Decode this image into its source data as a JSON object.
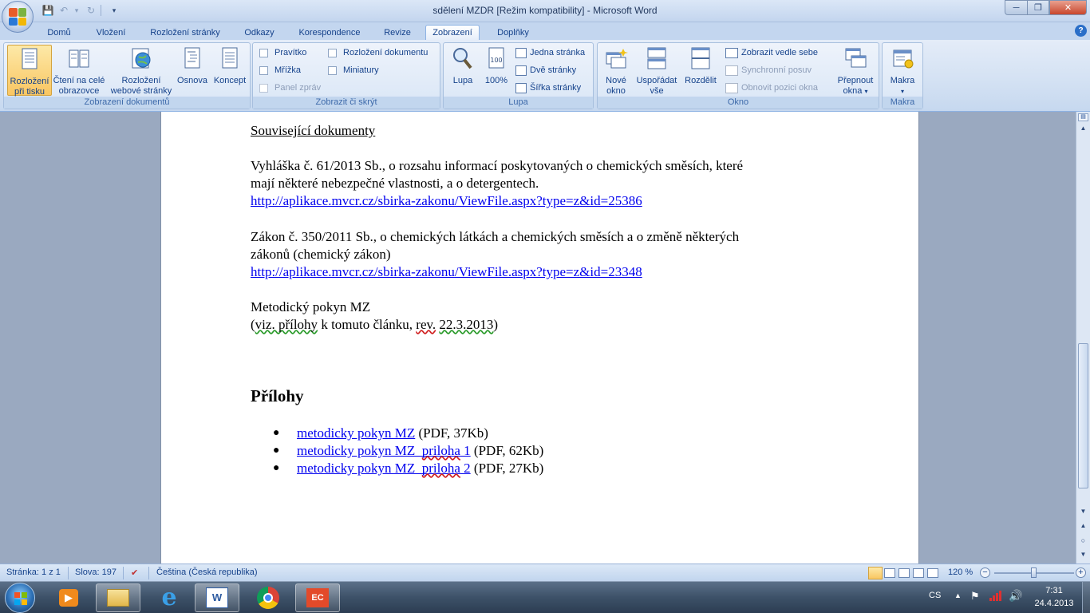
{
  "window": {
    "title": "sdělení MZDR [Režim kompatibility] - Microsoft Word"
  },
  "tabs": [
    "Domů",
    "Vložení",
    "Rozložení stránky",
    "Odkazy",
    "Korespondence",
    "Revize",
    "Zobrazení",
    "Doplňky"
  ],
  "ribbon": {
    "views": {
      "label": "Zobrazení dokumentů",
      "print_layout": [
        "Rozložení",
        "při tisku"
      ],
      "full_screen": [
        "Čtení na celé",
        "obrazovce"
      ],
      "web_layout": [
        "Rozložení",
        "webové stránky"
      ],
      "outline": "Osnova",
      "draft": "Koncept"
    },
    "show_hide": {
      "label": "Zobrazit či skrýt",
      "ruler": "Pravítko",
      "gridlines": "Mřížka",
      "message_bar": "Panel zpráv",
      "document_map": "Rozložení dokumentu",
      "thumbnails": "Miniatury"
    },
    "zoom": {
      "label": "Lupa",
      "zoom": "Lupa",
      "hundred": "100%",
      "one_page": "Jedna stránka",
      "two_pages": "Dvě stránky",
      "page_width": "Šířka stránky"
    },
    "window": {
      "label": "Okno",
      "new_window": [
        "Nové",
        "okno"
      ],
      "arrange_all": [
        "Uspořádat",
        "vše"
      ],
      "split": "Rozdělit",
      "side_by_side": "Zobrazit vedle sebe",
      "sync_scroll": "Synchronní posuv",
      "reset_position": "Obnovit pozici okna",
      "switch_windows": [
        "Přepnout",
        "okna"
      ]
    },
    "macros": {
      "label": "Makra",
      "macros": "Makra"
    }
  },
  "document": {
    "heading_related": "Související dokumenty",
    "p1_line1": "Vyhláška č. 61/2013 Sb., o rozsahu informací poskytovaných o chemických směsích, které",
    "p1_line2": "mají některé nebezpečné vlastnosti, a o detergentech.",
    "link1": "http://aplikace.mvcr.cz/sbirka-zakonu/ViewFile.aspx?type=z&id=25386",
    "p2_line1": "Zákon č. 350/2011 Sb., o chemických látkách a chemických směsích a o změně některých",
    "p2_line2": "zákonů (chemický zákon)",
    "link2": "http://aplikace.mvcr.cz/sbirka-zakonu/ViewFile.aspx?type=z&id=23348",
    "p3_line1": "Metodický pokyn MZ",
    "p3_line2_a": "(",
    "p3_line2_b": "viz. přílohy",
    "p3_line2_c": " k tomuto článku, ",
    "p3_line2_d": "rev.",
    "p3_line2_e": " ",
    "p3_line2_f": "22.3.2013",
    "p3_line2_g": ")",
    "heading_attachments": "Přílohy",
    "attachments": [
      {
        "link_a": "metodicky pokyn MZ",
        "link_b": "",
        "info": " (PDF, 37Kb)"
      },
      {
        "link_a": "metodicky pokyn MZ_",
        "link_b": "priloha",
        "link_c": " 1",
        "info": " (PDF, 62Kb)"
      },
      {
        "link_a": "metodicky pokyn MZ_",
        "link_b": "priloha",
        "link_c": " 2",
        "info": " (PDF, 27Kb)"
      }
    ]
  },
  "status": {
    "page": "Stránka: 1 z 1",
    "words": "Slova: 197",
    "language": "Čeština (Česká republika)",
    "zoom": "120 %"
  },
  "taskbar": {
    "lang": "CS",
    "time": "7:31",
    "date": "24.4.2013"
  },
  "colors": {
    "accent": "#15428b",
    "link": "#0000ee",
    "ribbon": "#d3e1f3"
  }
}
